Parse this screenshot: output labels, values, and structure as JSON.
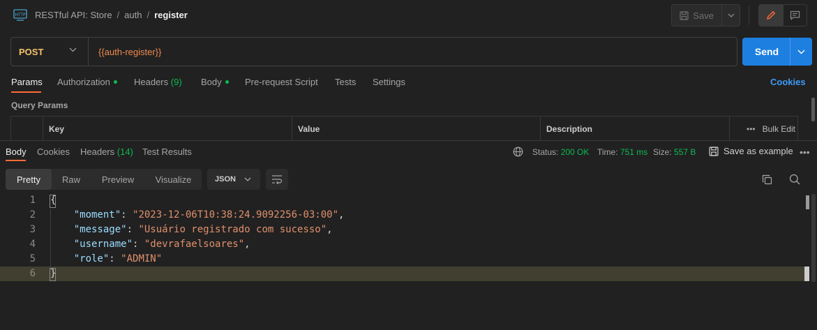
{
  "breadcrumb": {
    "collection": "RESTful API: Store",
    "folder": "auth",
    "request": "register"
  },
  "toolbar": {
    "save_label": "Save"
  },
  "request": {
    "method": "POST",
    "url": "{{auth-register}}",
    "send_label": "Send"
  },
  "request_tabs": {
    "params": "Params",
    "authorization": "Authorization",
    "headers": "Headers",
    "headers_count": "(9)",
    "body": "Body",
    "pre_request": "Pre-request Script",
    "tests": "Tests",
    "settings": "Settings",
    "cookies": "Cookies"
  },
  "query_params": {
    "title": "Query Params",
    "columns": [
      "Key",
      "Value",
      "Description"
    ],
    "bulk_edit": "Bulk Edit"
  },
  "response_tabs": {
    "body": "Body",
    "cookies": "Cookies",
    "headers": "Headers",
    "headers_count": "(14)",
    "test_results": "Test Results"
  },
  "response_meta": {
    "status_label": "Status:",
    "status_value": "200 OK",
    "time_label": "Time:",
    "time_value": "751 ms",
    "size_label": "Size:",
    "size_value": "557 B",
    "save_example": "Save as example"
  },
  "view_tabs": [
    "Pretty",
    "Raw",
    "Preview",
    "Visualize"
  ],
  "format_select": "JSON",
  "response_body": {
    "line_numbers": [
      "1",
      "2",
      "3",
      "4",
      "5",
      "6"
    ],
    "open_brace": "{",
    "close_brace": "}",
    "fields": [
      {
        "key": "\"moment\"",
        "value": "\"2023-12-06T10:38:24.9092256-03:00\"",
        "trail": ","
      },
      {
        "key": "\"message\"",
        "value": "\"Usuário registrado com sucesso\"",
        "trail": ","
      },
      {
        "key": "\"username\"",
        "value": "\"devrafaelsoares\"",
        "trail": ","
      },
      {
        "key": "\"role\"",
        "value": "\"ADMIN\"",
        "trail": ""
      }
    ]
  },
  "colors": {
    "accent": "#ff6c37",
    "send": "#1d7fe0",
    "status_ok": "#0cbb52",
    "method_post": "#f5c26b"
  }
}
